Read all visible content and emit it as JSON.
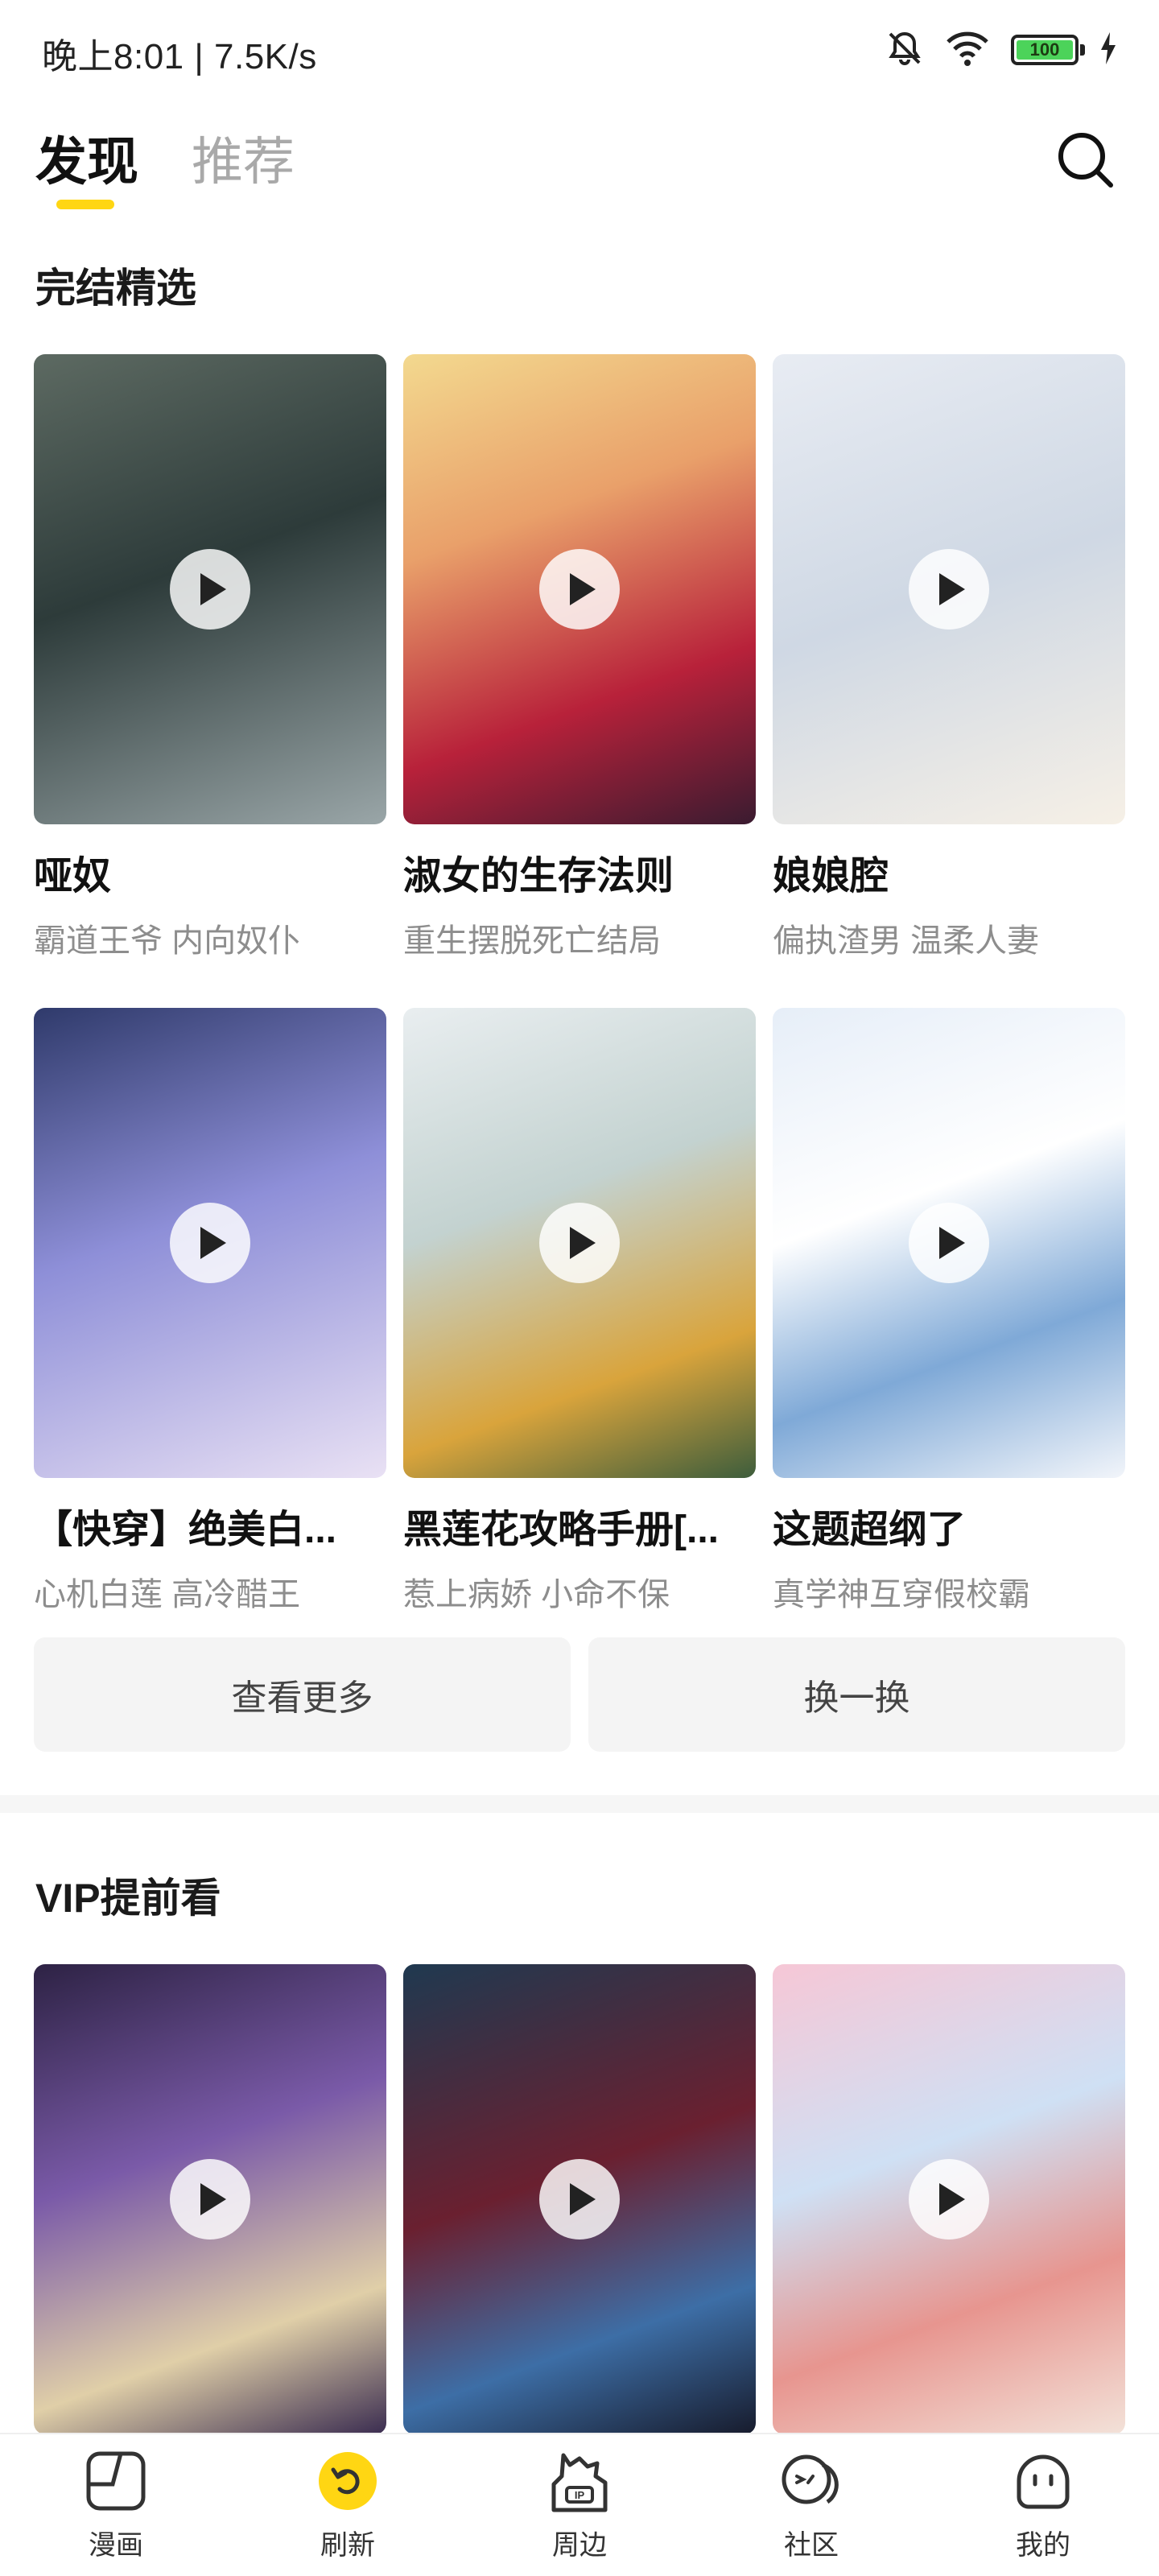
{
  "status_bar": {
    "time_speed": "晚上8:01 | 7.5K/s",
    "battery": "100"
  },
  "header": {
    "tabs": [
      {
        "label": "发现",
        "active": true
      },
      {
        "label": "推荐",
        "active": false
      }
    ]
  },
  "sections": [
    {
      "title": "完结精选",
      "items": [
        {
          "title": "哑奴",
          "tags": "霸道王爷 内向奴仆"
        },
        {
          "title": "淑女的生存法则",
          "tags": "重生摆脱死亡结局"
        },
        {
          "title": "娘娘腔",
          "tags": "偏执渣男 温柔人妻"
        },
        {
          "title": "【快穿】绝美白...",
          "tags": "心机白莲 高冷醋王"
        },
        {
          "title": "黑莲花攻略手册[...",
          "tags": "惹上病娇 小命不保"
        },
        {
          "title": "这题超纲了",
          "tags": "真学神互穿假校霸"
        }
      ],
      "actions": {
        "more": "查看更多",
        "refresh": "换一换"
      }
    },
    {
      "title": "VIP提前看",
      "items": [
        {},
        {},
        {}
      ]
    }
  ],
  "bottom_nav": [
    {
      "label": "漫画",
      "icon": "comic-icon",
      "active": false
    },
    {
      "label": "刷新",
      "icon": "refresh-icon",
      "active": true
    },
    {
      "label": "周边",
      "icon": "merch-ip-icon",
      "active": false
    },
    {
      "label": "社区",
      "icon": "community-icon",
      "active": false
    },
    {
      "label": "我的",
      "icon": "profile-icon",
      "active": false
    }
  ],
  "colors": {
    "accent": "#ffd613",
    "inactive_tab": "#a9a9a9",
    "subtitle": "#8d8d8d"
  }
}
